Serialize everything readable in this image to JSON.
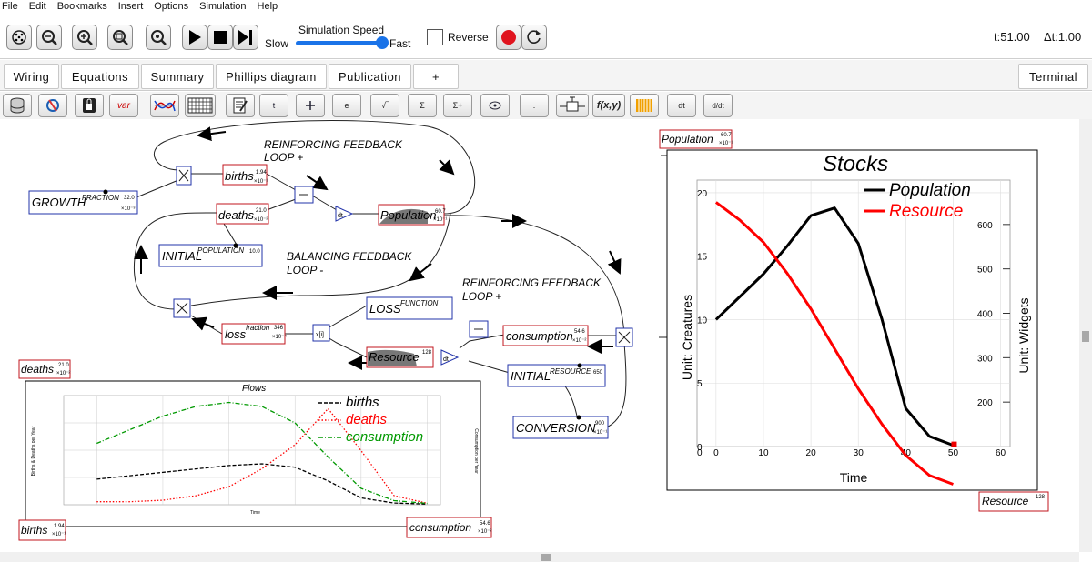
{
  "menu": [
    "File",
    "Edit",
    "Bookmarks",
    "Insert",
    "Options",
    "Simulation",
    "Help"
  ],
  "toolbar": {
    "speed_title": "Simulation Speed",
    "slow": "Slow",
    "fast": "Fast",
    "reverse": "Reverse",
    "t": "t:51.00",
    "dt": "Δt:1.00"
  },
  "tabs": {
    "wiring": "Wiring",
    "equations": "Equations",
    "summary": "Summary",
    "phillips": "Phillips diagram",
    "publication": "Publication",
    "add": "+",
    "terminal": "Terminal"
  },
  "icons": {
    "var": "var",
    "t": "t",
    "e": "e",
    "sqrt": "√‾",
    "sum": "Σ",
    "sumplus": "Σ+",
    "dot": ".",
    "fxy": "f(x,y)",
    "dt": "dt",
    "ddt": "d/dt"
  },
  "diagram": {
    "loop_r1_line1": "REINFORCING FEEDBACK",
    "loop_r1_line2": "LOOP +",
    "loop_b_line1": "BALANCING FEEDBACK",
    "loop_b_line2": "LOOP -",
    "loop_r2_line1": "REINFORCING FEEDBACK",
    "loop_r2_line2": "LOOP +",
    "growth": {
      "name": "GROWTH",
      "sup": "FRACTION",
      "val": "32.0",
      "exp": "×10⁻³"
    },
    "births": {
      "name": "births",
      "val": "1.94",
      "exp": "×10⁻¹"
    },
    "deaths": {
      "name": "deaths",
      "val": "21.0",
      "exp": "×10⁻²"
    },
    "population": {
      "name": "Population",
      "val": "60.7",
      "exp": "×10⁻¹"
    },
    "initpop": {
      "name": "INITIAL",
      "sup": "POPULATION",
      "val": "10.0"
    },
    "lossfrac": {
      "name": "loss",
      "sup": "fraction",
      "val": "346",
      "exp": "×10⁻⁴"
    },
    "lossfn": {
      "name": "LOSS",
      "sup": "FUNCTION"
    },
    "consumption": {
      "name": "consumption",
      "val": "54.6",
      "exp": "×10⁻²"
    },
    "resource": {
      "name": "Resource",
      "val": "128"
    },
    "initres": {
      "name": "INITIAL",
      "sup": "RESOURCE",
      "val": "650"
    },
    "conversion": {
      "name": "CONVERSION",
      "val": "900",
      "exp": "×10⁻¹"
    },
    "dt_label": "dt",
    "lookup_label": "x[i]"
  },
  "flows_panel": {
    "deaths": {
      "name": "deaths",
      "val": "21.0",
      "exp": "×10⁻²"
    },
    "births": {
      "name": "births",
      "val": "1.94",
      "exp": "×10⁻¹"
    },
    "consumption": {
      "name": "consumption",
      "val": "54.6",
      "exp": "×10⁻²"
    }
  },
  "stocks_panel": {
    "population": {
      "name": "Population",
      "val": "60.7",
      "exp": "×10⁻¹"
    },
    "resource": {
      "name": "Resource",
      "val": "128"
    }
  },
  "chart_data": [
    {
      "type": "line",
      "title": "Flows",
      "xlabel": "Time",
      "ylabel": "Births & Deaths per Year",
      "y2label": "Consumption per Year",
      "x": [
        0,
        5,
        10,
        15,
        20,
        25,
        30,
        35,
        40,
        45,
        50
      ],
      "series": [
        {
          "name": "births",
          "style": "dashed",
          "color": "#000000",
          "values": [
            0.075,
            0.085,
            0.095,
            0.105,
            0.115,
            0.12,
            0.11,
            0.07,
            0.02,
            0.005,
            0.002
          ]
        },
        {
          "name": "deaths",
          "style": "dotted",
          "color": "#ff0000",
          "values": [
            0.01,
            0.01,
            0.015,
            0.03,
            0.06,
            0.12,
            0.2,
            0.32,
            0.18,
            0.03,
            0.005
          ]
        },
        {
          "name": "consumption",
          "style": "dashdot",
          "color": "#009900",
          "values": [
            0.45,
            0.55,
            0.65,
            0.72,
            0.75,
            0.72,
            0.6,
            0.35,
            0.12,
            0.03,
            0.01
          ]
        }
      ],
      "legend": "top-right",
      "grid": true
    },
    {
      "type": "line",
      "title": "Stocks",
      "xlabel": "Time",
      "ylabel": "Unit: Creatures",
      "y2label": "Unit: Widgets",
      "x": [
        0,
        5,
        10,
        15,
        20,
        25,
        30,
        35,
        40,
        45,
        50
      ],
      "xticks": [
        0,
        10,
        20,
        30,
        40,
        50,
        60
      ],
      "yticks": [
        0,
        5,
        10,
        15,
        20
      ],
      "y2ticks": [
        200,
        300,
        400,
        500,
        600
      ],
      "ylim": [
        0,
        21
      ],
      "y2lim": [
        100,
        700
      ],
      "xlim": [
        -4,
        62
      ],
      "series": [
        {
          "name": "Population",
          "color": "#000000",
          "axis": "left",
          "values": [
            10,
            11.8,
            13.6,
            15.8,
            18.2,
            18.8,
            16,
            10,
            3,
            0.8,
            0.1
          ]
        },
        {
          "name": "Resource",
          "color": "#ff0000",
          "axis": "right",
          "values": [
            650,
            610,
            560,
            490,
            410,
            320,
            230,
            150,
            80,
            35,
            15
          ]
        }
      ],
      "legend": "top-right",
      "grid": true
    }
  ]
}
